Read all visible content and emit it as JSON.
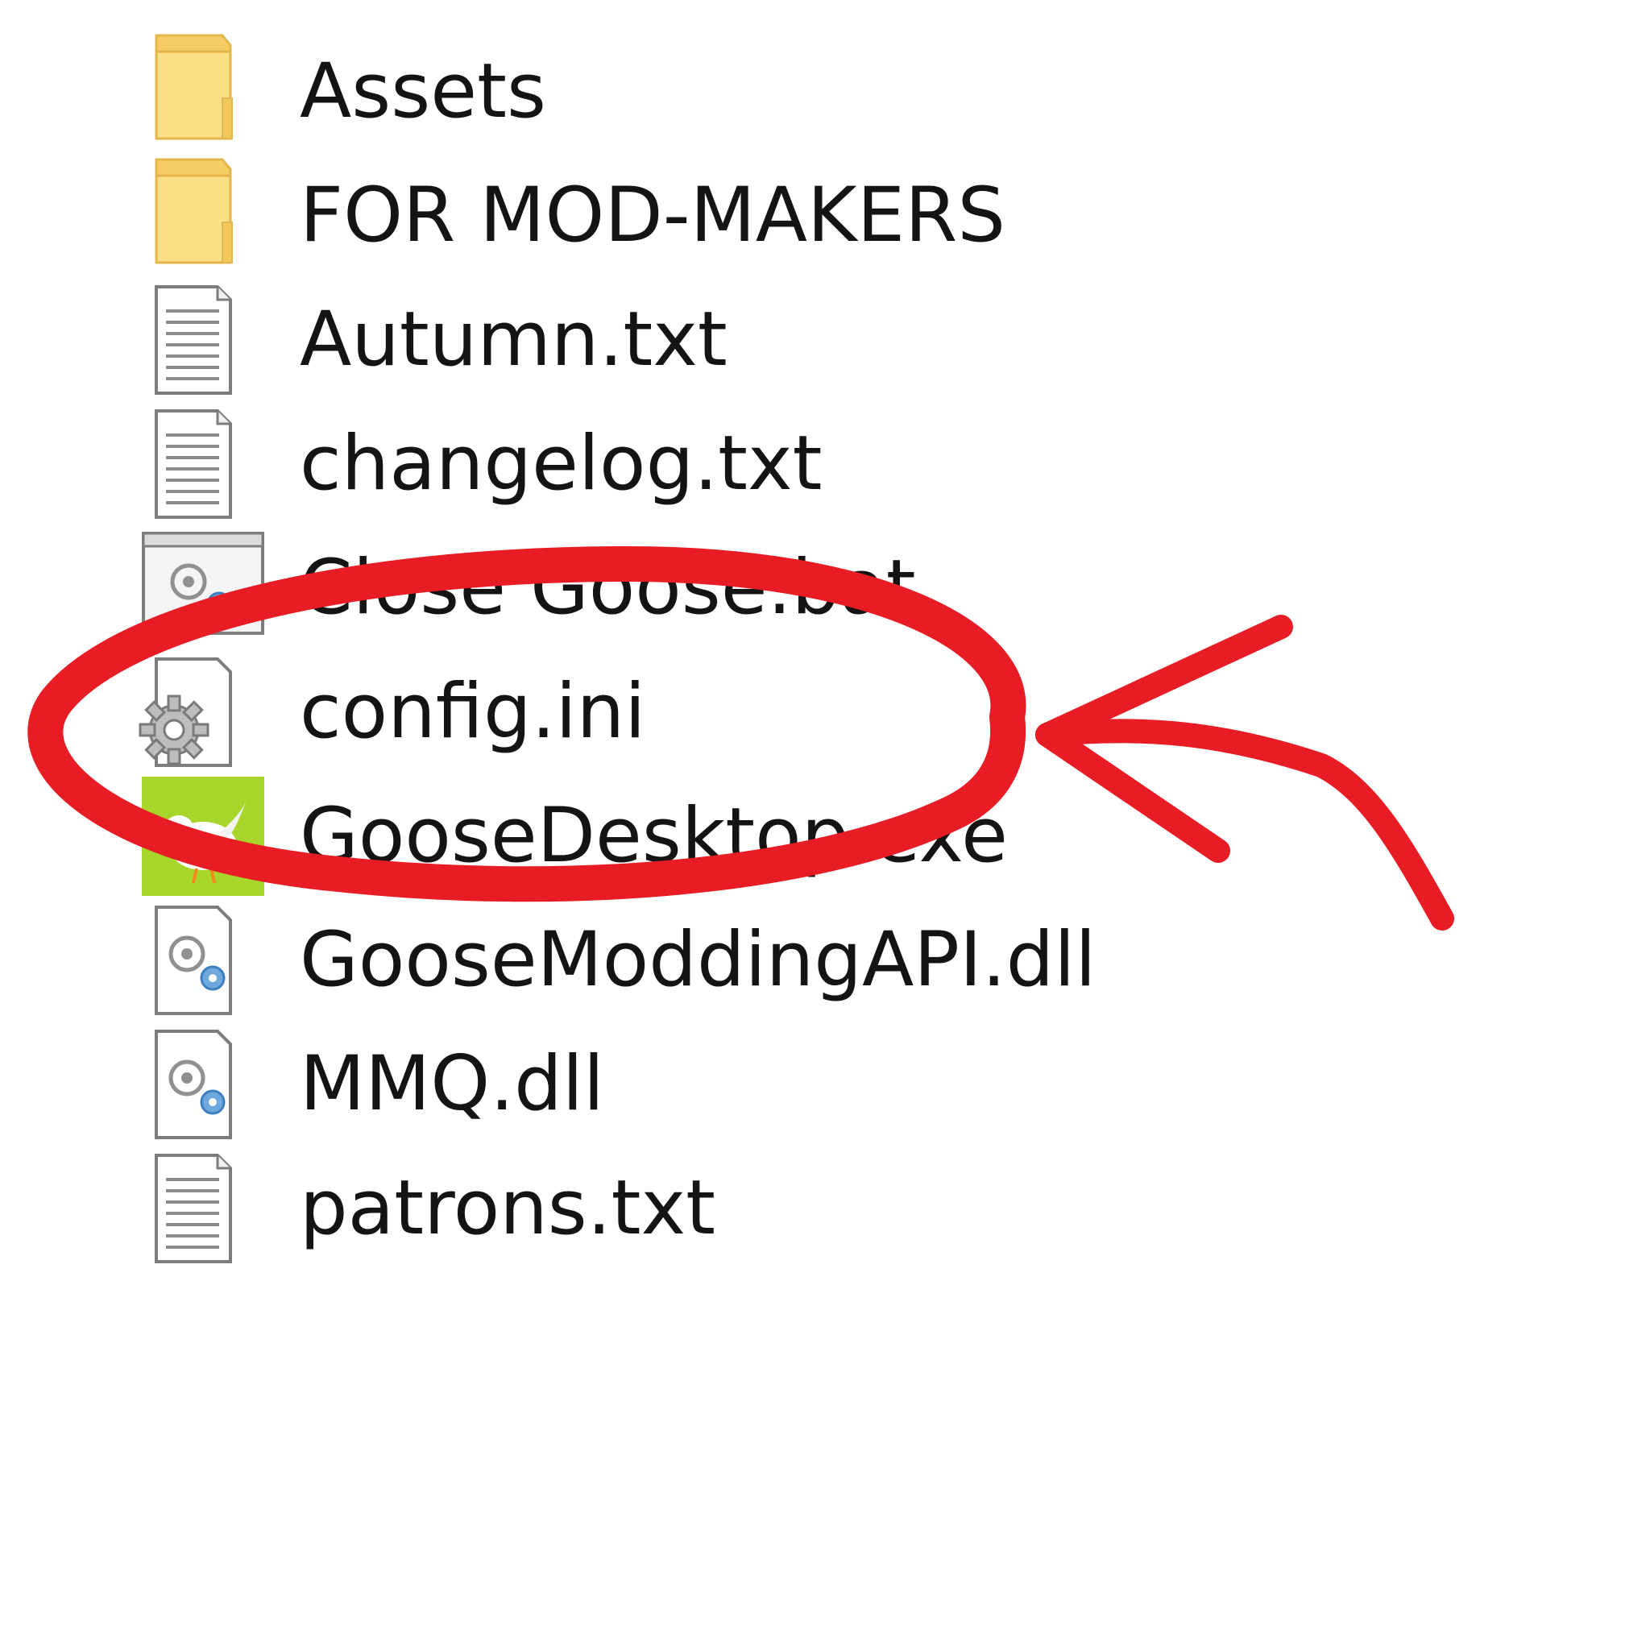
{
  "files": [
    {
      "name": "Assets",
      "icon": "folder-icon"
    },
    {
      "name": "FOR MOD-MAKERS",
      "icon": "folder-icon"
    },
    {
      "name": "Autumn.txt",
      "icon": "text-file-icon"
    },
    {
      "name": "changelog.txt",
      "icon": "text-file-icon"
    },
    {
      "name": "Close Goose.bat",
      "icon": "batch-file-icon"
    },
    {
      "name": "config.ini",
      "icon": "settings-file-icon"
    },
    {
      "name": "GooseDesktop.exe",
      "icon": "goose-app-icon"
    },
    {
      "name": "GooseModdingAPI.dll",
      "icon": "dll-file-icon"
    },
    {
      "name": "MMQ.dll",
      "icon": "dll-file-icon"
    },
    {
      "name": "patrons.txt",
      "icon": "text-file-icon"
    }
  ],
  "annotation": {
    "type": "hand-drawn circle and arrow",
    "target": "Close Goose.bat",
    "color": "#e81c24"
  },
  "colors": {
    "folder": "#f8d775",
    "folder_edge": "#e1b64c",
    "doc_border": "#7d7d7d",
    "exe_bg": "#a8d52a",
    "text": "#141414"
  }
}
